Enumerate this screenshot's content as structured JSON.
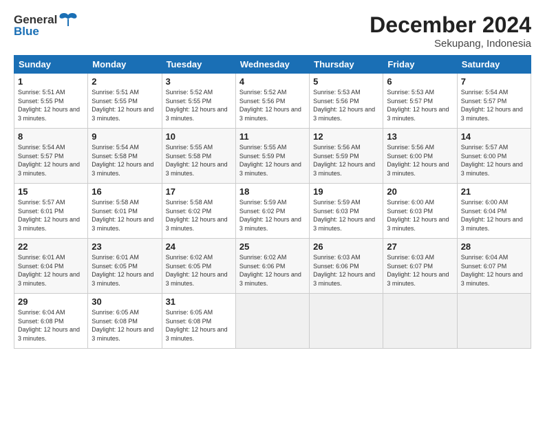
{
  "header": {
    "logo_general": "General",
    "logo_blue": "Blue",
    "title": "December 2024",
    "subtitle": "Sekupang, Indonesia"
  },
  "weekdays": [
    "Sunday",
    "Monday",
    "Tuesday",
    "Wednesday",
    "Thursday",
    "Friday",
    "Saturday"
  ],
  "weeks": [
    [
      {
        "day": "1",
        "sunrise": "5:51 AM",
        "sunset": "5:55 PM",
        "daylight": "12 hours and 3 minutes."
      },
      {
        "day": "2",
        "sunrise": "5:51 AM",
        "sunset": "5:55 PM",
        "daylight": "12 hours and 3 minutes."
      },
      {
        "day": "3",
        "sunrise": "5:52 AM",
        "sunset": "5:55 PM",
        "daylight": "12 hours and 3 minutes."
      },
      {
        "day": "4",
        "sunrise": "5:52 AM",
        "sunset": "5:56 PM",
        "daylight": "12 hours and 3 minutes."
      },
      {
        "day": "5",
        "sunrise": "5:53 AM",
        "sunset": "5:56 PM",
        "daylight": "12 hours and 3 minutes."
      },
      {
        "day": "6",
        "sunrise": "5:53 AM",
        "sunset": "5:57 PM",
        "daylight": "12 hours and 3 minutes."
      },
      {
        "day": "7",
        "sunrise": "5:54 AM",
        "sunset": "5:57 PM",
        "daylight": "12 hours and 3 minutes."
      }
    ],
    [
      {
        "day": "8",
        "sunrise": "5:54 AM",
        "sunset": "5:57 PM",
        "daylight": "12 hours and 3 minutes."
      },
      {
        "day": "9",
        "sunrise": "5:54 AM",
        "sunset": "5:58 PM",
        "daylight": "12 hours and 3 minutes."
      },
      {
        "day": "10",
        "sunrise": "5:55 AM",
        "sunset": "5:58 PM",
        "daylight": "12 hours and 3 minutes."
      },
      {
        "day": "11",
        "sunrise": "5:55 AM",
        "sunset": "5:59 PM",
        "daylight": "12 hours and 3 minutes."
      },
      {
        "day": "12",
        "sunrise": "5:56 AM",
        "sunset": "5:59 PM",
        "daylight": "12 hours and 3 minutes."
      },
      {
        "day": "13",
        "sunrise": "5:56 AM",
        "sunset": "6:00 PM",
        "daylight": "12 hours and 3 minutes."
      },
      {
        "day": "14",
        "sunrise": "5:57 AM",
        "sunset": "6:00 PM",
        "daylight": "12 hours and 3 minutes."
      }
    ],
    [
      {
        "day": "15",
        "sunrise": "5:57 AM",
        "sunset": "6:01 PM",
        "daylight": "12 hours and 3 minutes."
      },
      {
        "day": "16",
        "sunrise": "5:58 AM",
        "sunset": "6:01 PM",
        "daylight": "12 hours and 3 minutes."
      },
      {
        "day": "17",
        "sunrise": "5:58 AM",
        "sunset": "6:02 PM",
        "daylight": "12 hours and 3 minutes."
      },
      {
        "day": "18",
        "sunrise": "5:59 AM",
        "sunset": "6:02 PM",
        "daylight": "12 hours and 3 minutes."
      },
      {
        "day": "19",
        "sunrise": "5:59 AM",
        "sunset": "6:03 PM",
        "daylight": "12 hours and 3 minutes."
      },
      {
        "day": "20",
        "sunrise": "6:00 AM",
        "sunset": "6:03 PM",
        "daylight": "12 hours and 3 minutes."
      },
      {
        "day": "21",
        "sunrise": "6:00 AM",
        "sunset": "6:04 PM",
        "daylight": "12 hours and 3 minutes."
      }
    ],
    [
      {
        "day": "22",
        "sunrise": "6:01 AM",
        "sunset": "6:04 PM",
        "daylight": "12 hours and 3 minutes."
      },
      {
        "day": "23",
        "sunrise": "6:01 AM",
        "sunset": "6:05 PM",
        "daylight": "12 hours and 3 minutes."
      },
      {
        "day": "24",
        "sunrise": "6:02 AM",
        "sunset": "6:05 PM",
        "daylight": "12 hours and 3 minutes."
      },
      {
        "day": "25",
        "sunrise": "6:02 AM",
        "sunset": "6:06 PM",
        "daylight": "12 hours and 3 minutes."
      },
      {
        "day": "26",
        "sunrise": "6:03 AM",
        "sunset": "6:06 PM",
        "daylight": "12 hours and 3 minutes."
      },
      {
        "day": "27",
        "sunrise": "6:03 AM",
        "sunset": "6:07 PM",
        "daylight": "12 hours and 3 minutes."
      },
      {
        "day": "28",
        "sunrise": "6:04 AM",
        "sunset": "6:07 PM",
        "daylight": "12 hours and 3 minutes."
      }
    ],
    [
      {
        "day": "29",
        "sunrise": "6:04 AM",
        "sunset": "6:08 PM",
        "daylight": "12 hours and 3 minutes."
      },
      {
        "day": "30",
        "sunrise": "6:05 AM",
        "sunset": "6:08 PM",
        "daylight": "12 hours and 3 minutes."
      },
      {
        "day": "31",
        "sunrise": "6:05 AM",
        "sunset": "6:08 PM",
        "daylight": "12 hours and 3 minutes."
      },
      null,
      null,
      null,
      null
    ]
  ],
  "labels": {
    "sunrise": "Sunrise:",
    "sunset": "Sunset:",
    "daylight": "Daylight:"
  }
}
